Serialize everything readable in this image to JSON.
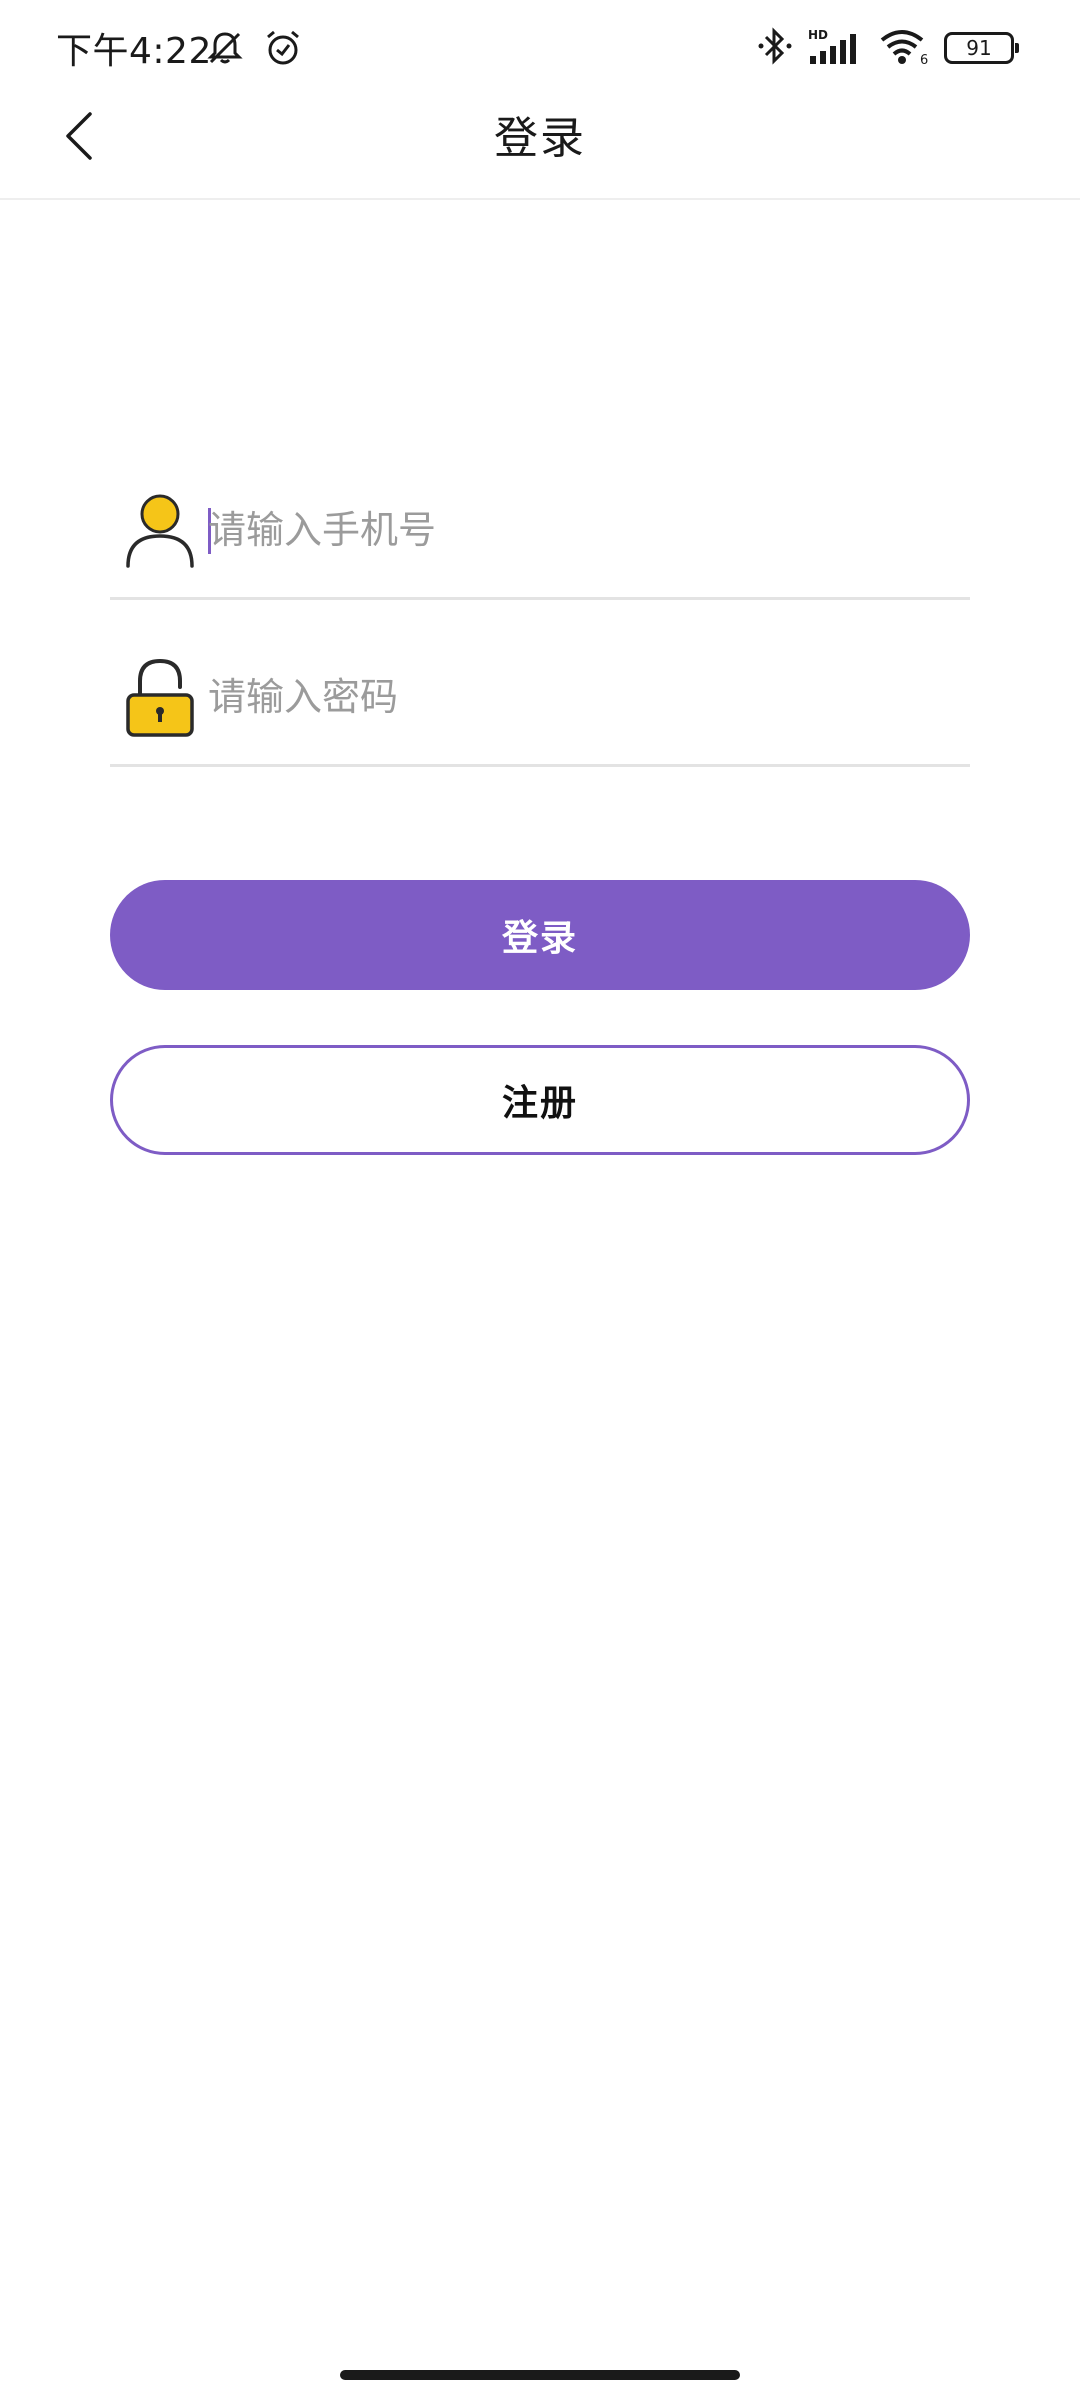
{
  "status_bar": {
    "time": "下午4:22",
    "left_icons": [
      "mute-bell-icon",
      "alarm-icon"
    ],
    "right_icons": [
      "bluetooth-icon",
      "hd-signal-icon",
      "wifi-icon"
    ],
    "hd_label": "HD",
    "wifi_label": "6",
    "battery": "91"
  },
  "nav": {
    "back_icon": "chevron-left-icon",
    "title": "登录"
  },
  "form": {
    "phone": {
      "icon": "user-icon",
      "placeholder": "请输入手机号",
      "value": ""
    },
    "password": {
      "icon": "padlock-icon",
      "placeholder": "请输入密码",
      "value": ""
    }
  },
  "actions": {
    "login_label": "登录",
    "register_label": "注册"
  },
  "colors": {
    "accent": "#7e5cc5",
    "icon_fill": "#f5c518",
    "divider": "#e3e3e3"
  }
}
